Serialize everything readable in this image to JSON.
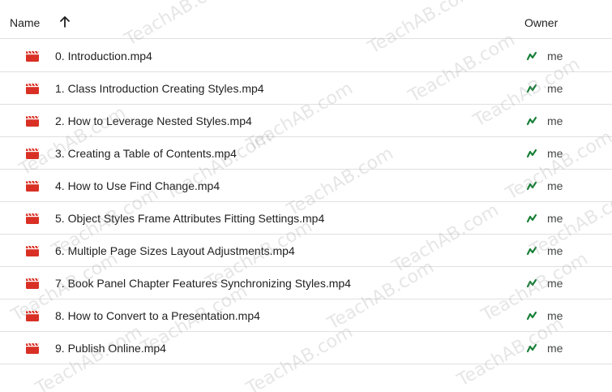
{
  "header": {
    "name_label": "Name",
    "owner_label": "Owner",
    "sort_icon": "arrow-up-icon"
  },
  "files": [
    {
      "name": "0. Introduction.mp4",
      "owner": "me"
    },
    {
      "name": "1. Class Introduction Creating Styles.mp4",
      "owner": "me"
    },
    {
      "name": "2. How to Leverage Nested Styles.mp4",
      "owner": "me"
    },
    {
      "name": "3. Creating a Table of Contents.mp4",
      "owner": "me"
    },
    {
      "name": "4. How to Use Find Change.mp4",
      "owner": "me"
    },
    {
      "name": "5. Object Styles Frame Attributes Fitting Settings.mp4",
      "owner": "me"
    },
    {
      "name": "6. Multiple Page Sizes Layout Adjustments.mp4",
      "owner": "me"
    },
    {
      "name": "7. Book Panel Chapter Features Synchronizing Styles.mp4",
      "owner": "me"
    },
    {
      "name": "8. How to Convert to a Presentation.mp4",
      "owner": "me"
    },
    {
      "name": "9. Publish Online.mp4",
      "owner": "me"
    }
  ],
  "icons": {
    "file_icon": "video-file-icon",
    "owner_icon": "shared-owner-icon"
  },
  "colors": {
    "video_icon": "#d93025",
    "owner_icon": "#188038",
    "divider": "#e0e0e0"
  },
  "watermark": {
    "text": "TeachAB.com"
  }
}
